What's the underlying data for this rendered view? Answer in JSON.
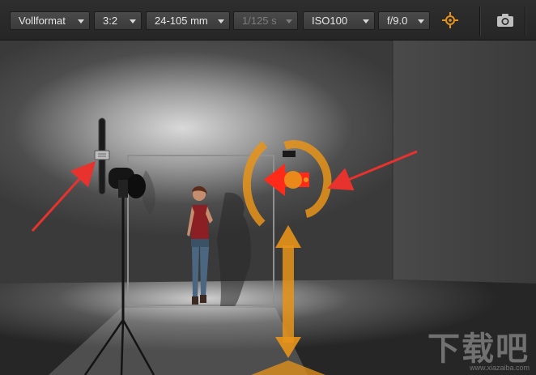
{
  "toolbar": {
    "format": "Vollformat",
    "aspect": "3:2",
    "lens": "24-105 mm",
    "shutter": "1/125 s",
    "iso": "ISO100",
    "aperture": "f/9.0"
  },
  "icons": {
    "target": "target-icon",
    "camera": "camera-icon"
  },
  "colors": {
    "accent": "#e8941a",
    "light_handle": "#ff2a1a",
    "annotation": "#e8322e"
  },
  "watermark": {
    "glyphs": "下载吧",
    "url": "www.xiazaiba.com"
  }
}
